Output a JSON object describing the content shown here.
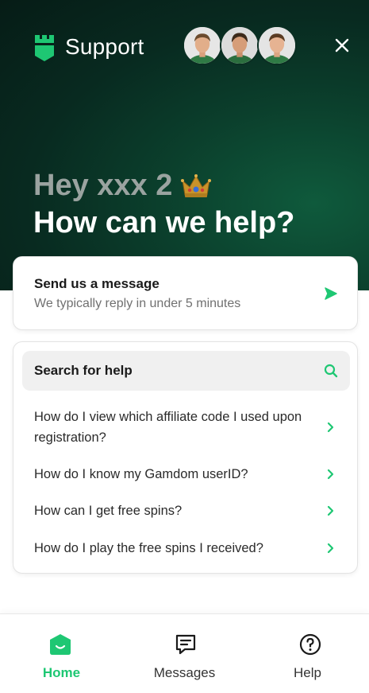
{
  "header": {
    "brand_name": "Support",
    "logo_icon": "gamdom-logo-icon",
    "close_icon": "close-icon",
    "avatars": [
      "agent-avatar-1",
      "agent-avatar-2",
      "agent-avatar-3"
    ]
  },
  "greeting": {
    "hello": "Hey xxx 2",
    "badge_icon": "crown-icon",
    "question": "How can we help?"
  },
  "message_card": {
    "title": "Send us a message",
    "subtitle": "We typically reply in under 5 minutes",
    "icon": "send-icon"
  },
  "help_card": {
    "search_label": "Search for help",
    "search_icon": "search-icon",
    "articles": [
      "How do I view which affiliate code I used upon registration?",
      "How do I know my Gamdom userID?",
      "How can I get free spins?",
      "How do I play the free spins I received?"
    ]
  },
  "nav": {
    "items": [
      {
        "label": "Home",
        "icon": "home-icon",
        "active": true
      },
      {
        "label": "Messages",
        "icon": "messages-icon",
        "active": false
      },
      {
        "label": "Help",
        "icon": "help-icon",
        "active": false
      }
    ]
  },
  "colors": {
    "accent": "#1ec773",
    "hero_dark": "#061c16",
    "hero_green": "#0f5a3c",
    "greeting_muted": "#9aa3a0"
  }
}
